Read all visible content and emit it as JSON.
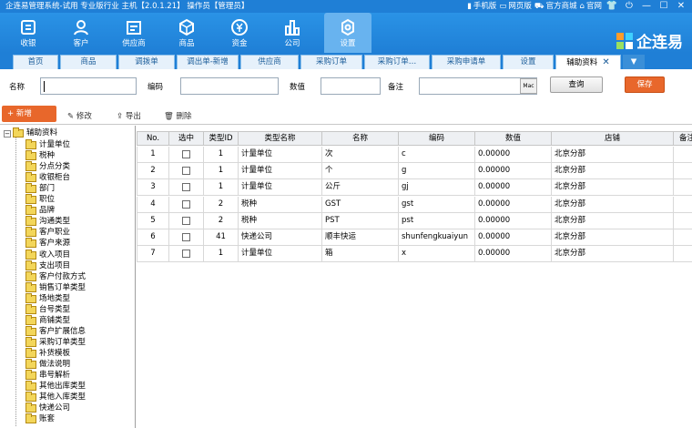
{
  "titlebar": {
    "title": "企连易管理系统-试用 专业版行业 主机【2.0.1.21】 操作员【管理员】",
    "links": [
      "手机版",
      "网页版",
      "官方商城",
      "官网"
    ]
  },
  "modules": [
    {
      "label": "收银",
      "icon": "cashier-icon"
    },
    {
      "label": "客户",
      "icon": "customer-icon"
    },
    {
      "label": "供应商",
      "icon": "supplier-icon"
    },
    {
      "label": "商品",
      "icon": "product-icon"
    },
    {
      "label": "资金",
      "icon": "money-icon"
    },
    {
      "label": "公司",
      "icon": "company-icon"
    },
    {
      "label": "设置",
      "icon": "settings-icon",
      "active": true
    }
  ],
  "logo": "企连易",
  "tabs": [
    "首页",
    "商品",
    "调拨单",
    "调出单-新增",
    "供应商",
    "采购订单",
    "采购订单…",
    "采购申请单",
    "设置",
    "辅助资料"
  ],
  "filter": {
    "name_label": "名称",
    "code_label": "编码",
    "value_label": "数值",
    "note_label": "备注",
    "mac_label": "Mac",
    "query_label": "查询",
    "save_label": "保存"
  },
  "toolbar": {
    "new_label": "+ 新增",
    "edit_label": "修改",
    "export_label": "导出",
    "delete_label": "删除"
  },
  "tree": {
    "root": "辅助资料",
    "items": [
      "计量单位",
      "税种",
      "分点分类",
      "收银柜台",
      "部门",
      "职位",
      "品牌",
      "沟通类型",
      "客户职业",
      "客户来源",
      "收入项目",
      "支出项目",
      "客户付款方式",
      "销售订单类型",
      "场地类型",
      "台号类型",
      "商铺类型",
      "客户扩展信息",
      "采购订单类型",
      "补货模板",
      "做法说明",
      "串号解析",
      "其他出库类型",
      "其他入库类型",
      "快递公司",
      "账套"
    ]
  },
  "grid": {
    "headers": [
      "No.",
      "选中",
      "类型ID",
      "类型名称",
      "名称",
      "编码",
      "数值",
      "店铺",
      "备注"
    ],
    "rows": [
      [
        "1",
        "",
        "1",
        "计量单位",
        "次",
        "c",
        "0.00000",
        "北京分部",
        ""
      ],
      [
        "2",
        "",
        "1",
        "计量单位",
        "个",
        "g",
        "0.00000",
        "北京分部",
        ""
      ],
      [
        "3",
        "",
        "1",
        "计量单位",
        "公斤",
        "gj",
        "0.00000",
        "北京分部",
        ""
      ],
      [
        "4",
        "",
        "2",
        "税种",
        "GST",
        "gst",
        "0.00000",
        "北京分部",
        ""
      ],
      [
        "5",
        "",
        "2",
        "税种",
        "PST",
        "pst",
        "0.00000",
        "北京分部",
        ""
      ],
      [
        "6",
        "",
        "41",
        "快递公司",
        "顺丰快运",
        "shunfengkuaiyun",
        "0.00000",
        "北京分部",
        ""
      ],
      [
        "7",
        "",
        "1",
        "计量单位",
        "箱",
        "x",
        "0.00000",
        "北京分部",
        ""
      ]
    ]
  }
}
